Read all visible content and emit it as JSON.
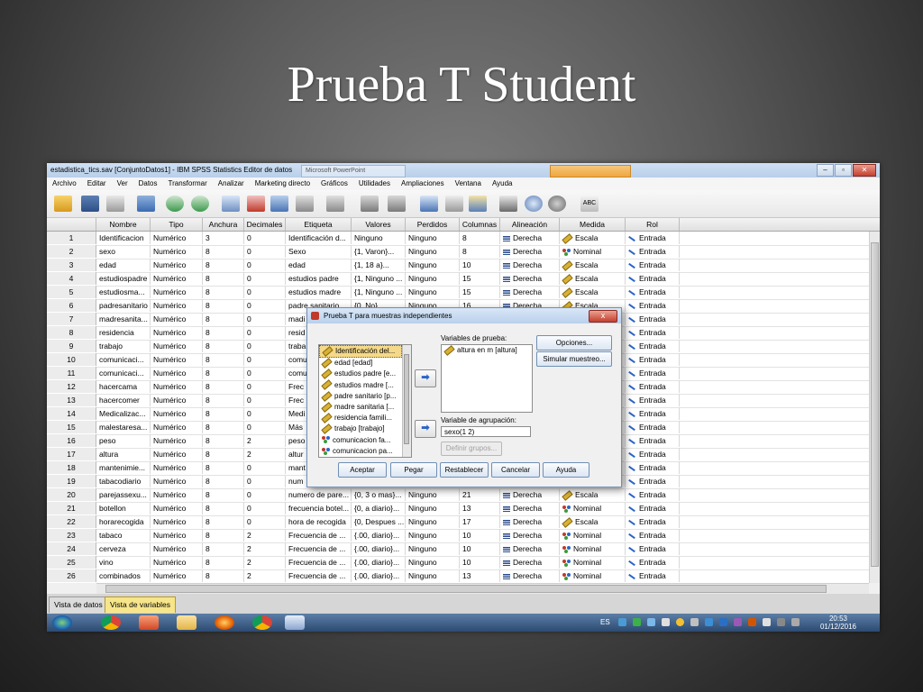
{
  "slide_title": "Prueba T Student",
  "window": {
    "title": "estadistica_tics.sav [ConjuntoDatos1] - IBM SPSS Statistics Editor de datos",
    "ghost_tab": "Microsoft PowerPoint"
  },
  "menu": [
    "Archivo",
    "Editar",
    "Ver",
    "Datos",
    "Transformar",
    "Analizar",
    "Marketing directo",
    "Gráficos",
    "Utilidades",
    "Ampliaciones",
    "Ventana",
    "Ayuda"
  ],
  "columns": [
    "Nombre",
    "Tipo",
    "Anchura",
    "Decimales",
    "Etiqueta",
    "Valores",
    "Perdidos",
    "Columnas",
    "Alineación",
    "Medida",
    "Rol"
  ],
  "rows": [
    {
      "n": "1",
      "nombre": "Identificacion",
      "tipo": "Numérico",
      "anchura": "3",
      "dec": "0",
      "etiqueta": "Identificación d...",
      "valores": "Ninguno",
      "perdidos": "Ninguno",
      "columnas": "8",
      "alineacion": "Derecha",
      "medida": "Escala",
      "rol": "Entrada"
    },
    {
      "n": "2",
      "nombre": "sexo",
      "tipo": "Numérico",
      "anchura": "8",
      "dec": "0",
      "etiqueta": "Sexo",
      "valores": "{1, Varon}...",
      "perdidos": "Ninguno",
      "columnas": "8",
      "alineacion": "Derecha",
      "medida": "Nominal",
      "rol": "Entrada"
    },
    {
      "n": "3",
      "nombre": "edad",
      "tipo": "Numérico",
      "anchura": "8",
      "dec": "0",
      "etiqueta": "edad",
      "valores": "{1, 18 a}...",
      "perdidos": "Ninguno",
      "columnas": "10",
      "alineacion": "Derecha",
      "medida": "Escala",
      "rol": "Entrada"
    },
    {
      "n": "4",
      "nombre": "estudiospadre",
      "tipo": "Numérico",
      "anchura": "8",
      "dec": "0",
      "etiqueta": "estudios padre",
      "valores": "{1, Ninguno ...",
      "perdidos": "Ninguno",
      "columnas": "15",
      "alineacion": "Derecha",
      "medida": "Escala",
      "rol": "Entrada"
    },
    {
      "n": "5",
      "nombre": "estudiosma...",
      "tipo": "Numérico",
      "anchura": "8",
      "dec": "0",
      "etiqueta": "estudios madre",
      "valores": "{1, Ninguno ...",
      "perdidos": "Ninguno",
      "columnas": "15",
      "alineacion": "Derecha",
      "medida": "Escala",
      "rol": "Entrada"
    },
    {
      "n": "6",
      "nombre": "padresanitario",
      "tipo": "Numérico",
      "anchura": "8",
      "dec": "0",
      "etiqueta": "padre sanitario",
      "valores": "{0, No}...",
      "perdidos": "Ninguno",
      "columnas": "16",
      "alineacion": "Derecha",
      "medida": "Escala",
      "rol": "Entrada"
    },
    {
      "n": "7",
      "nombre": "madresanita...",
      "tipo": "Numérico",
      "anchura": "8",
      "dec": "0",
      "etiqueta": "madi",
      "valores": "",
      "perdidos": "",
      "columnas": "",
      "alineacion": "Derecha",
      "medida": "",
      "rol": "Entrada"
    },
    {
      "n": "8",
      "nombre": "residencia",
      "tipo": "Numérico",
      "anchura": "8",
      "dec": "0",
      "etiqueta": "resid",
      "valores": "",
      "perdidos": "",
      "columnas": "",
      "alineacion": "",
      "medida": "",
      "rol": "Entrada"
    },
    {
      "n": "9",
      "nombre": "trabajo",
      "tipo": "Numérico",
      "anchura": "8",
      "dec": "0",
      "etiqueta": "traba",
      "valores": "",
      "perdidos": "",
      "columnas": "",
      "alineacion": "",
      "medida": "",
      "rol": "Entrada"
    },
    {
      "n": "10",
      "nombre": "comunicaci...",
      "tipo": "Numérico",
      "anchura": "8",
      "dec": "0",
      "etiqueta": "comu",
      "valores": "",
      "perdidos": "",
      "columnas": "",
      "alineacion": "",
      "medida": "",
      "rol": "Entrada"
    },
    {
      "n": "11",
      "nombre": "comunicaci...",
      "tipo": "Numérico",
      "anchura": "8",
      "dec": "0",
      "etiqueta": "comu",
      "valores": "",
      "perdidos": "",
      "columnas": "",
      "alineacion": "",
      "medida": "",
      "rol": "Entrada"
    },
    {
      "n": "12",
      "nombre": "hacercama",
      "tipo": "Numérico",
      "anchura": "8",
      "dec": "0",
      "etiqueta": "Frec",
      "valores": "",
      "perdidos": "",
      "columnas": "",
      "alineacion": "",
      "medida": "",
      "rol": "Entrada"
    },
    {
      "n": "13",
      "nombre": "hacercomer",
      "tipo": "Numérico",
      "anchura": "8",
      "dec": "0",
      "etiqueta": "Frec",
      "valores": "",
      "perdidos": "",
      "columnas": "",
      "alineacion": "",
      "medida": "",
      "rol": "Entrada"
    },
    {
      "n": "14",
      "nombre": "Medicalizac...",
      "tipo": "Numérico",
      "anchura": "8",
      "dec": "0",
      "etiqueta": "Medi",
      "valores": "",
      "perdidos": "",
      "columnas": "",
      "alineacion": "",
      "medida": "",
      "rol": "Entrada"
    },
    {
      "n": "15",
      "nombre": "malestaresa...",
      "tipo": "Numérico",
      "anchura": "8",
      "dec": "0",
      "etiqueta": "Más",
      "valores": "",
      "perdidos": "",
      "columnas": "",
      "alineacion": "",
      "medida": "",
      "rol": "Entrada"
    },
    {
      "n": "16",
      "nombre": "peso",
      "tipo": "Numérico",
      "anchura": "8",
      "dec": "2",
      "etiqueta": "peso",
      "valores": "",
      "perdidos": "",
      "columnas": "",
      "alineacion": "",
      "medida": "",
      "rol": "Entrada"
    },
    {
      "n": "17",
      "nombre": "altura",
      "tipo": "Numérico",
      "anchura": "8",
      "dec": "2",
      "etiqueta": "altur",
      "valores": "",
      "perdidos": "",
      "columnas": "",
      "alineacion": "",
      "medida": "",
      "rol": "Entrada"
    },
    {
      "n": "18",
      "nombre": "mantenimie...",
      "tipo": "Numérico",
      "anchura": "8",
      "dec": "0",
      "etiqueta": "mant",
      "valores": "",
      "perdidos": "",
      "columnas": "",
      "alineacion": "",
      "medida": "",
      "rol": "Entrada"
    },
    {
      "n": "19",
      "nombre": "tabacodiario",
      "tipo": "Numérico",
      "anchura": "8",
      "dec": "0",
      "etiqueta": "num",
      "valores": "",
      "perdidos": "",
      "columnas": "",
      "alineacion": "",
      "medida": "",
      "rol": "Entrada"
    },
    {
      "n": "20",
      "nombre": "parejassexu...",
      "tipo": "Numérico",
      "anchura": "8",
      "dec": "0",
      "etiqueta": "numero de pare...",
      "valores": "{0, 3 o mas}...",
      "perdidos": "Ninguno",
      "columnas": "21",
      "alineacion": "Derecha",
      "medida": "Escala",
      "rol": "Entrada"
    },
    {
      "n": "21",
      "nombre": "botellon",
      "tipo": "Numérico",
      "anchura": "8",
      "dec": "0",
      "etiqueta": "frecuencia botel...",
      "valores": "{0, a diario}...",
      "perdidos": "Ninguno",
      "columnas": "13",
      "alineacion": "Derecha",
      "medida": "Nominal",
      "rol": "Entrada"
    },
    {
      "n": "22",
      "nombre": "horarecogida",
      "tipo": "Numérico",
      "anchura": "8",
      "dec": "0",
      "etiqueta": "hora de recogida",
      "valores": "{0, Despues ...",
      "perdidos": "Ninguno",
      "columnas": "17",
      "alineacion": "Derecha",
      "medida": "Escala",
      "rol": "Entrada"
    },
    {
      "n": "23",
      "nombre": "tabaco",
      "tipo": "Numérico",
      "anchura": "8",
      "dec": "2",
      "etiqueta": "Frecuencia de ...",
      "valores": "{.00, diario}...",
      "perdidos": "Ninguno",
      "columnas": "10",
      "alineacion": "Derecha",
      "medida": "Nominal",
      "rol": "Entrada"
    },
    {
      "n": "24",
      "nombre": "cerveza",
      "tipo": "Numérico",
      "anchura": "8",
      "dec": "2",
      "etiqueta": "Frecuencia de ...",
      "valores": "{.00, diario}...",
      "perdidos": "Ninguno",
      "columnas": "10",
      "alineacion": "Derecha",
      "medida": "Nominal",
      "rol": "Entrada"
    },
    {
      "n": "25",
      "nombre": "vino",
      "tipo": "Numérico",
      "anchura": "8",
      "dec": "2",
      "etiqueta": "Frecuencia de ...",
      "valores": "{.00, diario}...",
      "perdidos": "Ninguno",
      "columnas": "10",
      "alineacion": "Derecha",
      "medida": "Nominal",
      "rol": "Entrada"
    },
    {
      "n": "26",
      "nombre": "combinados",
      "tipo": "Numérico",
      "anchura": "8",
      "dec": "2",
      "etiqueta": "Frecuencia de ...",
      "valores": "{.00, diario}...",
      "perdidos": "Ninguno",
      "columnas": "13",
      "alineacion": "Derecha",
      "medida": "Nominal",
      "rol": "Entrada"
    }
  ],
  "dialog": {
    "title": "Prueba T para muestras independientes",
    "close": "x",
    "source_items": [
      "Identificación del...",
      "edad [edad]",
      "estudios padre [e...",
      "estudios madre [...",
      "padre sanitario [p...",
      "madre sanitaria [...",
      "residencia famili...",
      "trabajo [trabajo]",
      "comunicacion fa...",
      "comunicacion pa..."
    ],
    "test_label": "Variables de prueba:",
    "test_items": [
      "altura en m [altura]"
    ],
    "group_label": "Variable de agrupación:",
    "group_value": "sexo(1 2)",
    "define_groups": "Definir grupos...",
    "options": "Opciones...",
    "simulate": "Simular muestreo...",
    "buttons": [
      "Aceptar",
      "Pegar",
      "Restablecer",
      "Cancelar",
      "Ayuda"
    ],
    "move_arrow": "➡"
  },
  "tabs": [
    "Vista de datos",
    "Vista de variables"
  ],
  "taskbar": {
    "lang": "ES",
    "time": "20:53",
    "date": "01/12/2016"
  }
}
